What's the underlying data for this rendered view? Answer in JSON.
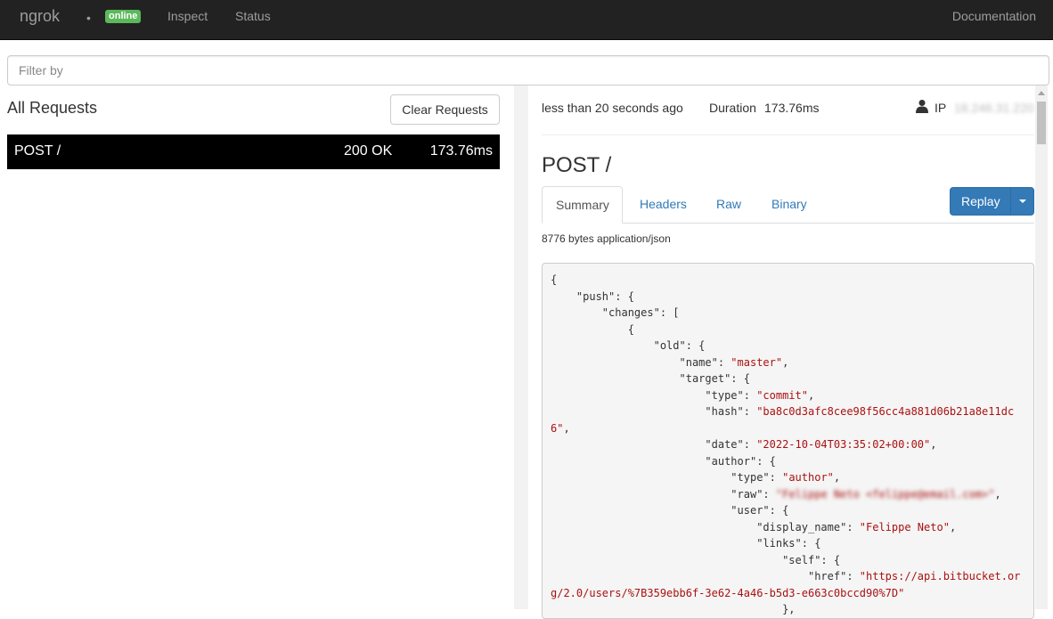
{
  "navbar": {
    "brand": "ngrok",
    "dot": "•",
    "status_badge": "online",
    "inspect": "Inspect",
    "status": "Status",
    "documentation": "Documentation"
  },
  "filter": {
    "placeholder": "Filter by"
  },
  "requests": {
    "title": "All Requests",
    "clear_label": "Clear Requests",
    "items": [
      {
        "method_path": "POST /",
        "status": "200 OK",
        "duration": "173.76ms"
      }
    ]
  },
  "detail": {
    "time": "less than 20 seconds ago",
    "duration_label": "Duration",
    "duration": "173.76ms",
    "ip_label": "IP",
    "ip": "18.246.31.220",
    "title": "POST /",
    "tabs": [
      "Summary",
      "Headers",
      "Raw",
      "Binary"
    ],
    "replay_label": "Replay",
    "content_info": "8776 bytes application/json"
  },
  "code_lines": [
    [
      {
        "t": "{"
      }
    ],
    [
      {
        "t": "    \"push\": {"
      }
    ],
    [
      {
        "t": "        \"changes\": ["
      }
    ],
    [
      {
        "t": "            {"
      }
    ],
    [
      {
        "t": "                \"old\": {"
      }
    ],
    [
      {
        "t": "                    \"name\": "
      },
      {
        "t": "\"master\"",
        "c": "str"
      },
      {
        "t": ","
      }
    ],
    [
      {
        "t": "                    \"target\": {"
      }
    ],
    [
      {
        "t": "                        \"type\": "
      },
      {
        "t": "\"commit\"",
        "c": "str"
      },
      {
        "t": ","
      }
    ],
    [
      {
        "t": "                        \"hash\": "
      },
      {
        "t": "\"ba8c0d3afc8cee98f56cc4a881d06b21a8e11dc",
        "c": "str"
      }
    ],
    [
      {
        "t": "6\"",
        "c": "str"
      },
      {
        "t": ","
      }
    ],
    [
      {
        "t": "                        \"date\": "
      },
      {
        "t": "\"2022-10-04T03:35:02+00:00\"",
        "c": "str"
      },
      {
        "t": ","
      }
    ],
    [
      {
        "t": "                        \"author\": {"
      }
    ],
    [
      {
        "t": "                            \"type\": "
      },
      {
        "t": "\"author\"",
        "c": "str"
      },
      {
        "t": ","
      }
    ],
    [
      {
        "t": "                            \"raw\": "
      },
      {
        "t": "\"Felippe Neto <felippe@email.com>\"",
        "c": "blurred"
      },
      {
        "t": ","
      }
    ],
    [
      {
        "t": "                            \"user\": {"
      }
    ],
    [
      {
        "t": "                                \"display_name\": "
      },
      {
        "t": "\"Felippe Neto\"",
        "c": "str"
      },
      {
        "t": ","
      }
    ],
    [
      {
        "t": "                                \"links\": {"
      }
    ],
    [
      {
        "t": "                                    \"self\": {"
      }
    ],
    [
      {
        "t": "                                        \"href\": "
      },
      {
        "t": "\"https://api.bitbucket.or",
        "c": "str"
      }
    ],
    [
      {
        "t": "g/2.0/users/%7B359ebb6f-3e62-4a46-b5d3-e663c0bccd90%7D\"",
        "c": "str"
      }
    ],
    [
      {
        "t": "                                    },"
      }
    ]
  ]
}
